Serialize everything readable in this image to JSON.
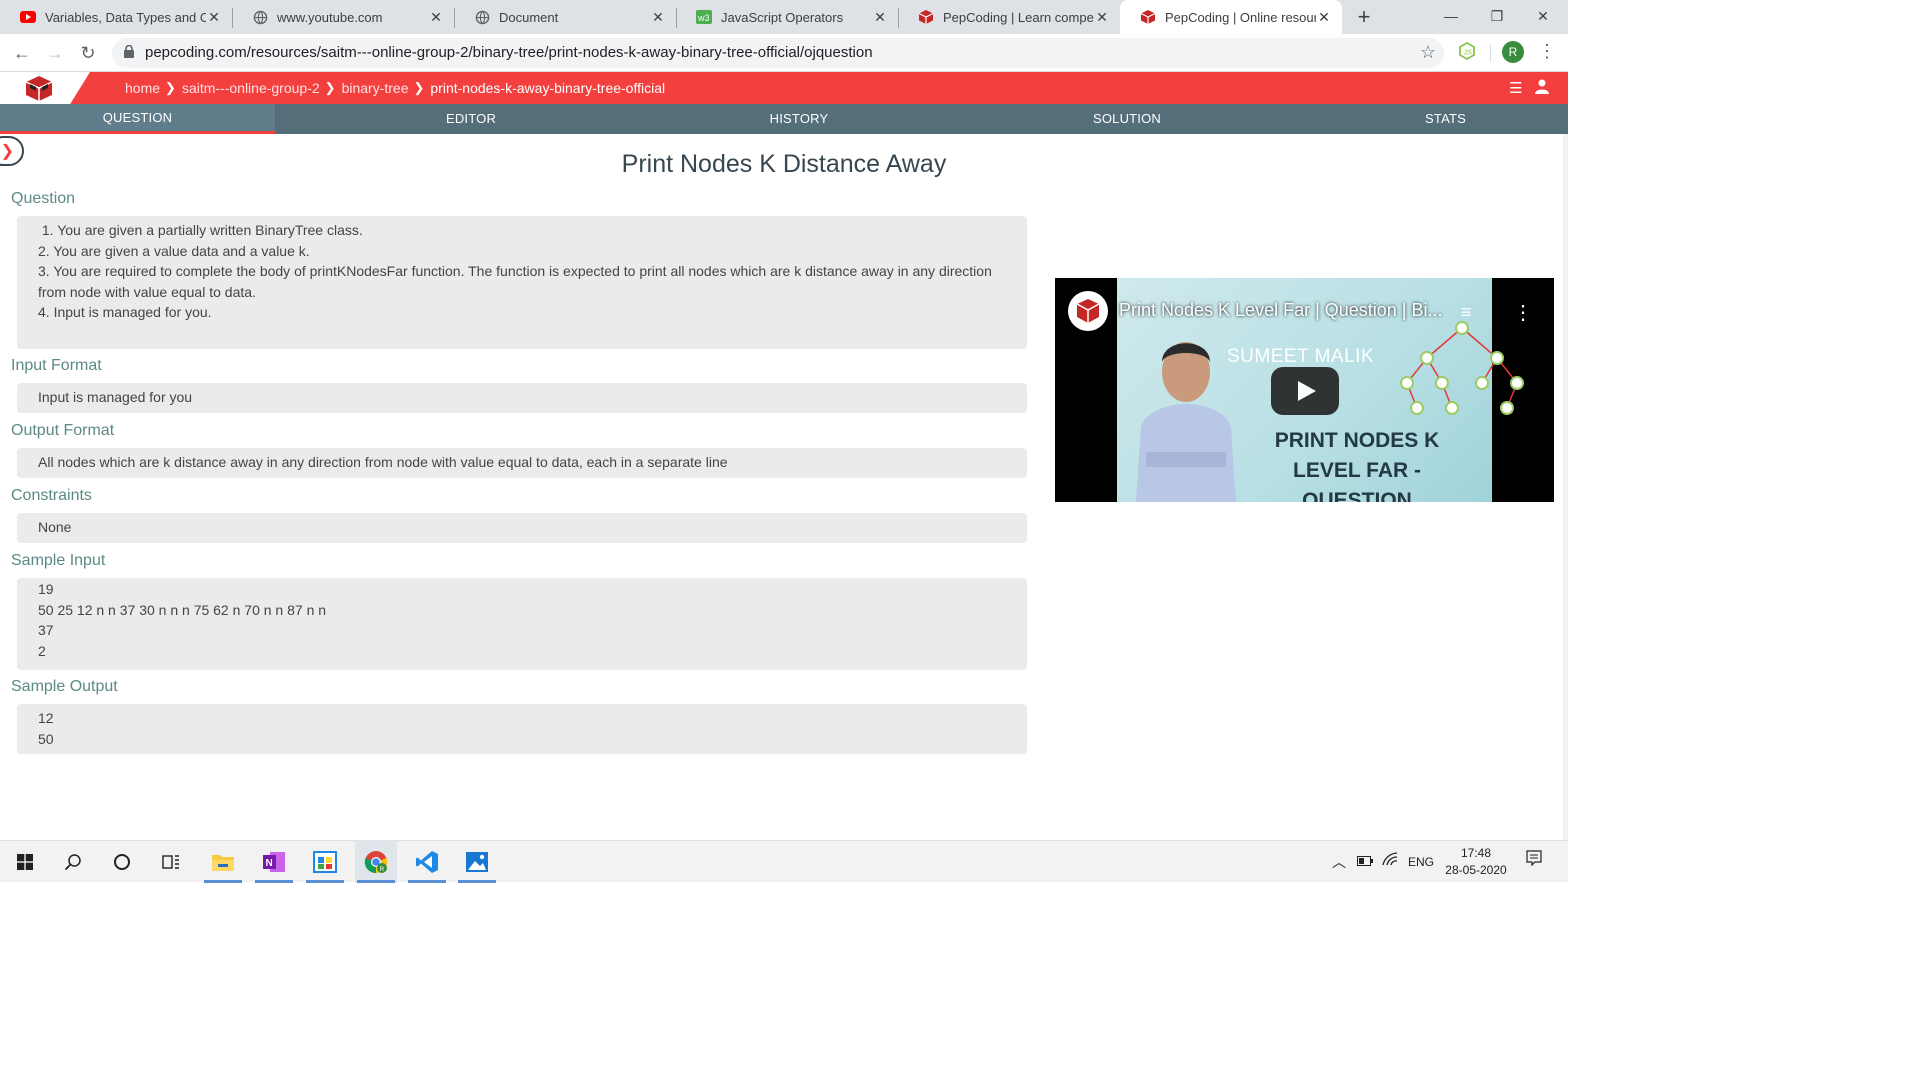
{
  "browser": {
    "tabs": [
      {
        "title": "Variables, Data Types and Op",
        "icon": "youtube-icon"
      },
      {
        "title": "www.youtube.com",
        "icon": "globe-icon"
      },
      {
        "title": "Document",
        "icon": "globe-icon"
      },
      {
        "title": "JavaScript Operators",
        "icon": "w3schools-icon"
      },
      {
        "title": "PepCoding | Learn competiti",
        "icon": "pepcoding-icon"
      },
      {
        "title": "PepCoding | Online resource",
        "icon": "pepcoding-icon",
        "active": true
      }
    ],
    "url": "pepcoding.com/resources/saitm---online-group-2/binary-tree/print-nodes-k-away-binary-tree-official/ojquestion",
    "profile_initial": "R"
  },
  "header": {
    "breadcrumbs": [
      "home",
      "saitm---online-group-2",
      "binary-tree",
      "print-nodes-k-away-binary-tree-official"
    ],
    "brand_color": "#f43f3f"
  },
  "nav_tabs": [
    "QUESTION",
    "EDITOR",
    "HISTORY",
    "SOLUTION",
    "STATS"
  ],
  "problem": {
    "title": "Print Nodes K Distance Away",
    "question_label": "Question",
    "question_lines": [
      " 1. You are given a partially written BinaryTree class.",
      "2. You are given a value data and a value k.",
      "3. You are required to complete the body of printKNodesFar function. The function is expected to print all nodes which are k distance away in any direction from node with value equal to data.",
      "4. Input is managed for you."
    ],
    "input_format_label": "Input Format",
    "input_format": "Input is managed for you",
    "output_format_label": "Output Format",
    "output_format": "All nodes which are k distance away in any direction from node with value equal to data, each in a separate line",
    "constraints_label": "Constraints",
    "constraints": "None",
    "sample_input_label": "Sample Input",
    "sample_input": [
      "19",
      "50 25 12 n n 37 30 n n n 75 62 n 70 n n 87 n n",
      "37",
      "2"
    ],
    "sample_output_label": "Sample Output",
    "sample_output": [
      "12",
      "50"
    ]
  },
  "video": {
    "title": "Print Nodes K Level Far | Question | Bi...",
    "thumb_author": "SUMEET MALIK",
    "thumb_title": "PRINT NODES K LEVEL FAR - QUESTION"
  },
  "taskbar": {
    "lang": "ENG",
    "time": "17:48",
    "date": "28-05-2020"
  }
}
